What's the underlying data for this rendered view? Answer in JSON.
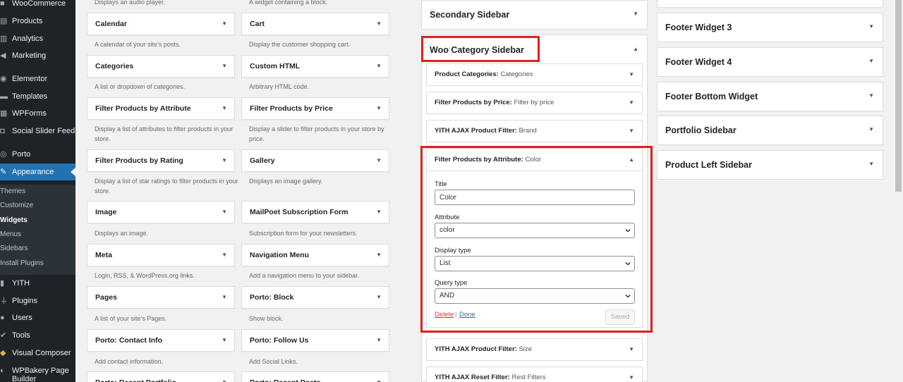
{
  "admin_menu": {
    "items": [
      {
        "label": "WooCommerce",
        "icon": "woocommerce-icon"
      },
      {
        "label": "Products",
        "icon": "products-icon"
      },
      {
        "label": "Analytics",
        "icon": "analytics-icon"
      },
      {
        "label": "Marketing",
        "icon": "megaphone-icon"
      },
      {
        "label": "Elementor",
        "icon": "elementor-icon"
      },
      {
        "label": "Templates",
        "icon": "folder-icon"
      },
      {
        "label": "WPForms",
        "icon": "forms-icon"
      },
      {
        "label": "Social Slider Feeds",
        "icon": "instagram-icon"
      },
      {
        "label": "Porto",
        "icon": "porto-icon"
      },
      {
        "label": "Appearance",
        "icon": "brush-icon"
      }
    ],
    "submenu": [
      "Themes",
      "Customize",
      "Widgets",
      "Menus",
      "Sidebars",
      "Install Plugins"
    ],
    "items_after": [
      {
        "label": "YITH",
        "icon": "yith-icon"
      },
      {
        "label": "Plugins",
        "icon": "plugin-icon"
      },
      {
        "label": "Users",
        "icon": "users-icon"
      },
      {
        "label": "Tools",
        "icon": "wrench-icon"
      },
      {
        "label": "Visual Composer",
        "icon": "vc-icon"
      },
      {
        "label": "WPBakery Page Builder",
        "icon": "wpbakery-icon"
      }
    ]
  },
  "available_widgets": {
    "top_desc_left": "Displays an audio player.",
    "top_desc_right": "A widget containing a block.",
    "left": [
      {
        "title": "Calendar",
        "desc": "A calendar of your site’s posts."
      },
      {
        "title": "Categories",
        "desc": "A list or dropdown of categories."
      },
      {
        "title": "Filter Products by Attribute",
        "desc": "Display a list of attributes to filter products in your store."
      },
      {
        "title": "Filter Products by Rating",
        "desc": "Display a list of star ratings to filter products in your store."
      },
      {
        "title": "Image",
        "desc": "Displays an image."
      },
      {
        "title": "Meta",
        "desc": "Login, RSS, & WordPress.org links."
      },
      {
        "title": "Pages",
        "desc": "A list of your site’s Pages."
      },
      {
        "title": "Porto: Contact Info",
        "desc": "Add contact information."
      },
      {
        "title": "Porto: Recent Portfolio",
        "desc": ""
      }
    ],
    "right": [
      {
        "title": "Cart",
        "desc": "Display the customer shopping cart."
      },
      {
        "title": "Custom HTML",
        "desc": "Arbitrary HTML code."
      },
      {
        "title": "Filter Products by Price",
        "desc": "Display a slider to filter products in your store by price."
      },
      {
        "title": "Gallery",
        "desc": "Displays an image gallery."
      },
      {
        "title": "MailPoet Subscription Form",
        "desc": "Subscription form for your newsletters."
      },
      {
        "title": "Navigation Menu",
        "desc": "Add a navigation menu to your sidebar."
      },
      {
        "title": "Porto: Block",
        "desc": "Show block."
      },
      {
        "title": "Porto: Follow Us",
        "desc": "Add Social Links."
      },
      {
        "title": "Porto: Recent Posts",
        "desc": ""
      }
    ]
  },
  "sidebars": {
    "secondary": "Secondary Sidebar",
    "woo_category": "Woo Category Sidebar",
    "right_column": [
      "Footer Widget 3",
      "Footer Widget 4",
      "Footer Bottom Widget",
      "Portfolio Sidebar",
      "Product Left Sidebar"
    ]
  },
  "woo_widgets": [
    {
      "title": "Product Categories:",
      "sub": "Categories"
    },
    {
      "title": "Filter Products by Price:",
      "sub": "Filter by price"
    },
    {
      "title": "YITH AJAX Product Filter:",
      "sub": "Brand"
    },
    {
      "title": "Filter Products by Attribute:",
      "sub": "Color"
    },
    {
      "title": "YITH AJAX Product Filter:",
      "sub": "Size"
    },
    {
      "title": "YITH AJAX Reset Filter:",
      "sub": "Rest Filters"
    }
  ],
  "widget_form": {
    "title_label": "Title",
    "title_value": "Color",
    "attribute_label": "Attribute",
    "attribute_value": "color",
    "display_type_label": "Display type",
    "display_type_value": "List",
    "query_type_label": "Query type",
    "query_type_value": "AND",
    "delete_label": "Delete",
    "separator": "|",
    "done_label": "Done",
    "saved_label": "Saved"
  },
  "colors": {
    "highlight": "#e0201c",
    "admin_bg": "#1d2327",
    "accent": "#2271b1"
  }
}
